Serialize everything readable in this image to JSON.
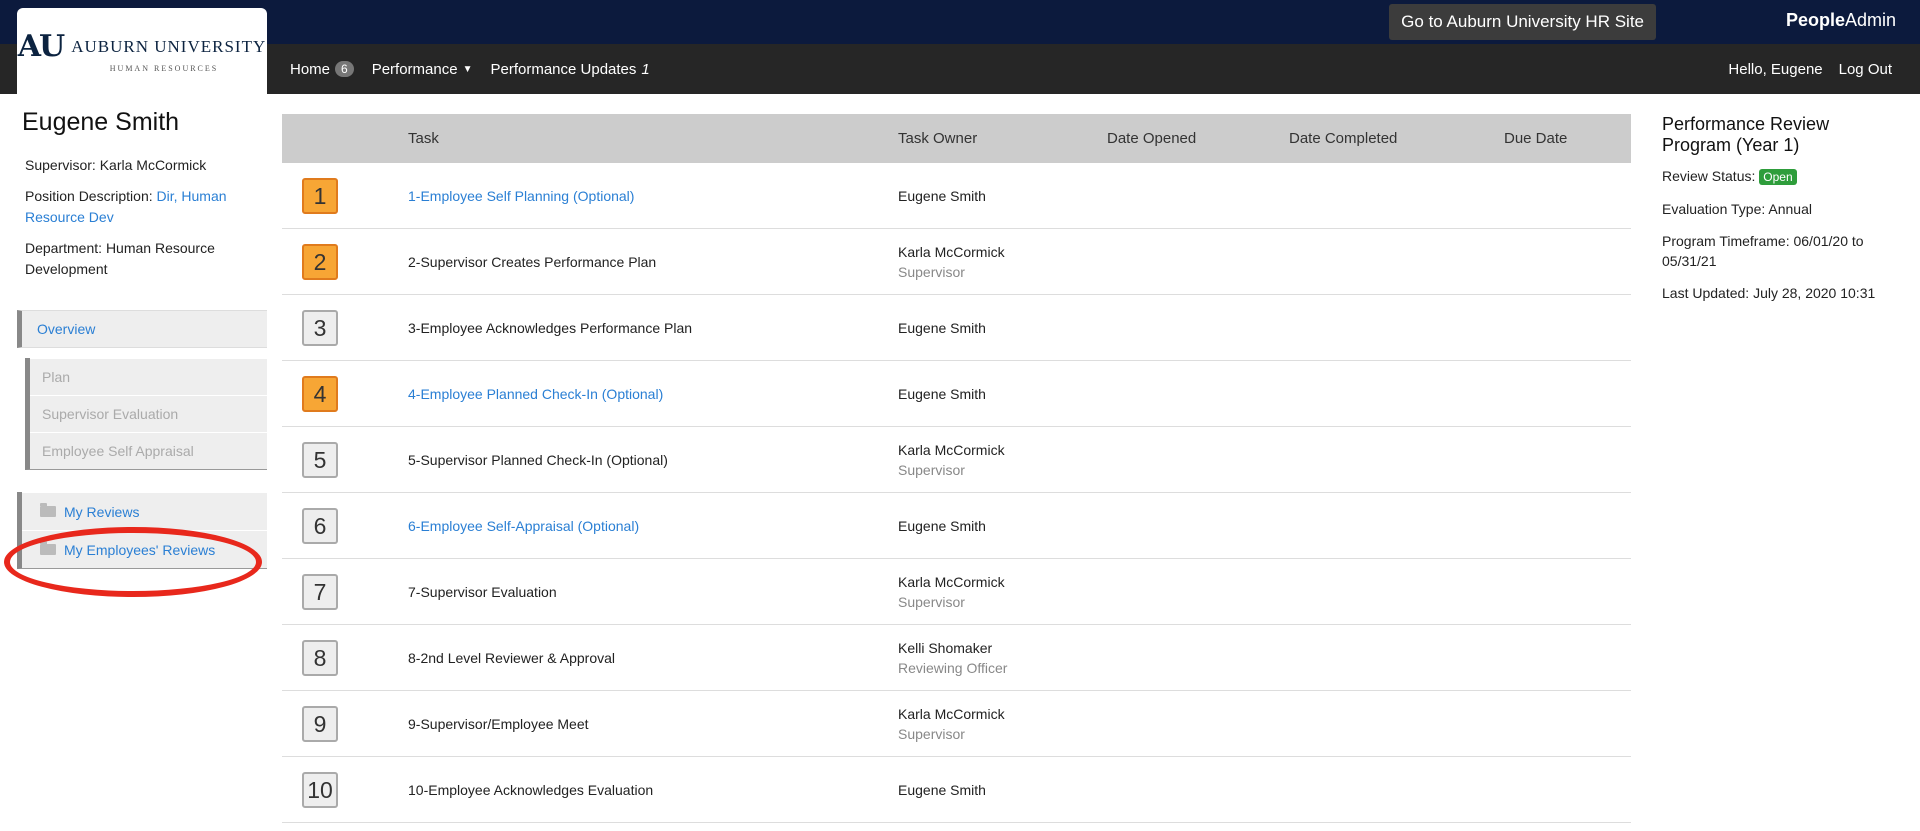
{
  "header": {
    "hr_site_button": "Go to Auburn University HR Site",
    "brand_people": "People",
    "brand_admin": "Admin",
    "logo_name": "AUBURN UNIVERSITY",
    "logo_sub": "HUMAN RESOURCES",
    "logo_mark": "AU"
  },
  "nav": {
    "home_label": "Home",
    "home_badge": "6",
    "performance_label": "Performance",
    "updates_label": "Performance Updates",
    "updates_badge": "1",
    "greeting": "Hello, Eugene",
    "logout": "Log Out"
  },
  "sidebar": {
    "name": "Eugene Smith",
    "supervisor_label": "Supervisor:",
    "supervisor_value": "Karla McCormick",
    "position_label": "Position Description:",
    "position_value": "Dir, Human Resource Dev",
    "department_label": "Department:",
    "department_value": "Human Resource Development",
    "overview": "Overview",
    "subitems": [
      "Plan",
      "Supervisor Evaluation",
      "Employee Self Appraisal"
    ],
    "my_reviews": "My Reviews",
    "my_employees_reviews": "My Employees' Reviews"
  },
  "table": {
    "headers": {
      "task": "Task",
      "owner": "Task Owner",
      "opened": "Date Opened",
      "completed": "Date Completed",
      "due": "Due Date"
    },
    "rows": [
      {
        "num": "1",
        "task": "1-Employee Self Planning (Optional)",
        "owner": "Eugene Smith",
        "role": "",
        "active": true,
        "link": true
      },
      {
        "num": "2",
        "task": "2-Supervisor Creates Performance Plan",
        "owner": "Karla McCormick",
        "role": "Supervisor",
        "active": true,
        "link": false
      },
      {
        "num": "3",
        "task": "3-Employee Acknowledges Performance Plan",
        "owner": "Eugene Smith",
        "role": "",
        "active": false,
        "link": false
      },
      {
        "num": "4",
        "task": "4-Employee Planned Check-In (Optional)",
        "owner": "Eugene Smith",
        "role": "",
        "active": true,
        "link": true
      },
      {
        "num": "5",
        "task": "5-Supervisor Planned Check-In (Optional)",
        "owner": "Karla McCormick",
        "role": "Supervisor",
        "active": false,
        "link": false
      },
      {
        "num": "6",
        "task": "6-Employee Self-Appraisal (Optional)",
        "owner": "Eugene Smith",
        "role": "",
        "active": false,
        "link": true
      },
      {
        "num": "7",
        "task": "7-Supervisor Evaluation",
        "owner": "Karla McCormick",
        "role": "Supervisor",
        "active": false,
        "link": false
      },
      {
        "num": "8",
        "task": "8-2nd Level Reviewer & Approval",
        "owner": "Kelli Shomaker",
        "role": "Reviewing Officer",
        "active": false,
        "link": false
      },
      {
        "num": "9",
        "task": "9-Supervisor/Employee Meet",
        "owner": "Karla McCormick",
        "role": "Supervisor",
        "active": false,
        "link": false
      },
      {
        "num": "10",
        "task": "10-Employee Acknowledges Evaluation",
        "owner": "Eugene Smith",
        "role": "",
        "active": false,
        "link": false
      }
    ]
  },
  "summary": {
    "title": "Performance Review Program (Year 1)",
    "status_label": "Review Status:",
    "status_value": "Open",
    "eval_label": "Evaluation Type:",
    "eval_value": "Annual",
    "timeframe_label": "Program Timeframe:",
    "timeframe_value": "06/01/20 to 05/31/21",
    "updated_label": "Last Updated:",
    "updated_value": "July 28, 2020 10:31"
  }
}
